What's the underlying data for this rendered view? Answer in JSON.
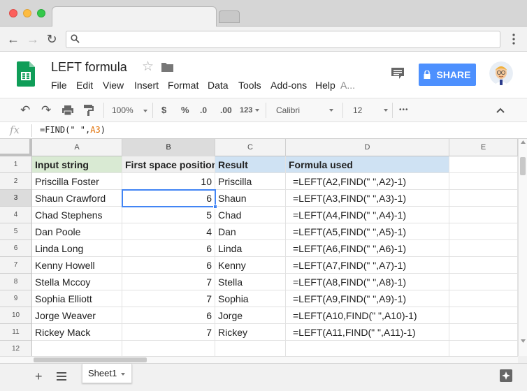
{
  "doc": {
    "title": "LEFT formula"
  },
  "menu": [
    "File",
    "Edit",
    "View",
    "Insert",
    "Format",
    "Data",
    "Tools",
    "Add-ons",
    "Help",
    "A..."
  ],
  "share_label": "SHARE",
  "toolbar": {
    "zoom": "100%",
    "currency": "$",
    "percent": "%",
    "dec_less": ".0",
    "dec_more": ".00",
    "more_formats": "123",
    "font": "Calibri",
    "font_size": "12",
    "more": "•••"
  },
  "formula_bar": {
    "fx": "fx",
    "prefix": "=FIND(\" \",",
    "ref": "A3",
    "suffix": ")"
  },
  "columns": [
    "A",
    "B",
    "C",
    "D",
    "E"
  ],
  "rows": [
    "1",
    "2",
    "3",
    "4",
    "5",
    "6",
    "7",
    "8",
    "9",
    "10",
    "11",
    "12"
  ],
  "header_row": {
    "a": "Input string",
    "b": "First space position",
    "c": "Result",
    "d": "Formula used"
  },
  "data_rows": [
    {
      "a": "Priscilla Foster",
      "b": "10",
      "c": "Priscilla",
      "d": "=LEFT(A2,FIND(\" \",A2)-1)"
    },
    {
      "a": "Shaun Crawford",
      "b": "6",
      "c": "Shaun",
      "d": "=LEFT(A3,FIND(\" \",A3)-1)"
    },
    {
      "a": "Chad Stephens",
      "b": "5",
      "c": "Chad",
      "d": "=LEFT(A4,FIND(\" \",A4)-1)"
    },
    {
      "a": "Dan Poole",
      "b": "4",
      "c": "Dan",
      "d": "=LEFT(A5,FIND(\" \",A5)-1)"
    },
    {
      "a": "Linda Long",
      "b": "6",
      "c": "Linda",
      "d": "=LEFT(A6,FIND(\" \",A6)-1)"
    },
    {
      "a": "Kenny Howell",
      "b": "6",
      "c": "Kenny",
      "d": "=LEFT(A7,FIND(\" \",A7)-1)"
    },
    {
      "a": "Stella Mccoy",
      "b": "7",
      "c": "Stella",
      "d": "=LEFT(A8,FIND(\" \",A8)-1)"
    },
    {
      "a": "Sophia Elliott",
      "b": "7",
      "c": "Sophia",
      "d": "=LEFT(A9,FIND(\" \",A9)-1)"
    },
    {
      "a": "Jorge Weaver",
      "b": "6",
      "c": "Jorge",
      "d": "=LEFT(A10,FIND(\" \",A10)-1)"
    },
    {
      "a": "Rickey Mack",
      "b": "7",
      "c": "Rickey",
      "d": "=LEFT(A11,FIND(\" \",A11)-1)"
    }
  ],
  "selected_cell": "B3",
  "sheet_tab": "Sheet1",
  "colors": {
    "header_green": "#d9ead3",
    "header_gray": "#efefef",
    "header_blue": "#cfe2f3",
    "share_blue": "#4d90fe",
    "selection_blue": "#4285f4",
    "sheets_green": "#0f9d58"
  }
}
